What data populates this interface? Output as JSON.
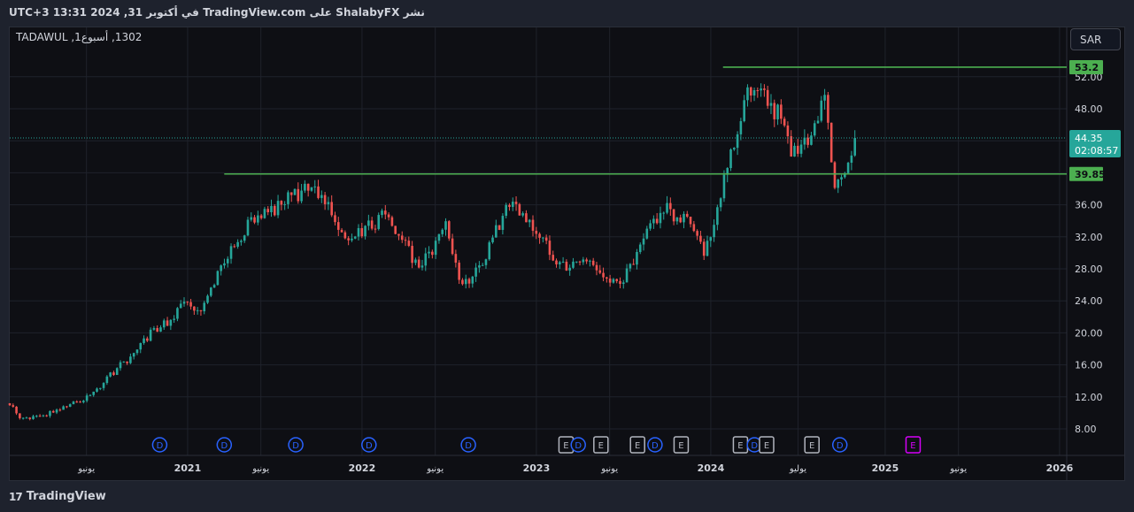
{
  "header": {
    "publish_note": "نشر ShalabyFX على TradingView.com في أكتوبر 31, 2024 13:31 UTC+3",
    "symbol_line": "1302, أسبوع1, TADAWUL",
    "currency": "SAR"
  },
  "footer": {
    "brand_mark": "17",
    "brand": "TradingView"
  },
  "colors": {
    "up": "#26a69a",
    "down": "#ef5350",
    "level": "#4caf50",
    "last_price": "#26a69a",
    "dividend": "#2962ff",
    "earnings": "#b2b5be",
    "earnings_future": "#d500f9",
    "background": "#0e0f14",
    "grid": "#1f222b"
  },
  "chart_data": {
    "type": "candlestick",
    "symbol": "1302",
    "exchange": "TADAWUL",
    "interval": "أسبوع1",
    "currency": "SAR",
    "ylim": [
      6,
      54.5
    ],
    "y_ticks": [
      "8.00",
      "12.00",
      "16.00",
      "20.00",
      "24.00",
      "28.00",
      "32.00",
      "36.00",
      "40.00",
      "44.00",
      "48.00",
      "52.00"
    ],
    "x_ticks": [
      {
        "label": "يونيو",
        "kind": "month",
        "t": 2020.42
      },
      {
        "label": "2021",
        "kind": "year",
        "t": 2021.0
      },
      {
        "label": "يونيو",
        "kind": "month",
        "t": 2021.42
      },
      {
        "label": "2022",
        "kind": "year",
        "t": 2022.0
      },
      {
        "label": "يونيو",
        "kind": "month",
        "t": 2022.42
      },
      {
        "label": "2023",
        "kind": "year",
        "t": 2023.0
      },
      {
        "label": "يونيو",
        "kind": "month",
        "t": 2023.42
      },
      {
        "label": "2024",
        "kind": "year",
        "t": 2024.0
      },
      {
        "label": "يوليو",
        "kind": "month",
        "t": 2024.5
      },
      {
        "label": "2025",
        "kind": "year",
        "t": 2025.0
      },
      {
        "label": "يونيو",
        "kind": "month",
        "t": 2025.42
      },
      {
        "label": "2026",
        "kind": "year",
        "t": 2026.0
      }
    ],
    "price_path": [
      [
        2019.98,
        11.2
      ],
      [
        2020.05,
        9.2
      ],
      [
        2020.12,
        9.6
      ],
      [
        2020.2,
        9.9
      ],
      [
        2020.28,
        10.6
      ],
      [
        2020.38,
        11.4
      ],
      [
        2020.48,
        12.9
      ],
      [
        2020.58,
        15.2
      ],
      [
        2020.68,
        17.2
      ],
      [
        2020.78,
        19.8
      ],
      [
        2020.88,
        21.4
      ],
      [
        2020.98,
        23.5
      ],
      [
        2021.08,
        22.8
      ],
      [
        2021.18,
        27.5
      ],
      [
        2021.28,
        31.5
      ],
      [
        2021.38,
        34.2
      ],
      [
        2021.5,
        35.5
      ],
      [
        2021.62,
        37.3
      ],
      [
        2021.72,
        38.5
      ],
      [
        2021.82,
        35.8
      ],
      [
        2021.92,
        31.0
      ],
      [
        2022.02,
        33.0
      ],
      [
        2022.12,
        34.5
      ],
      [
        2022.22,
        31.8
      ],
      [
        2022.32,
        28.5
      ],
      [
        2022.4,
        30.0
      ],
      [
        2022.48,
        33.5
      ],
      [
        2022.55,
        27.0
      ],
      [
        2022.62,
        26.5
      ],
      [
        2022.7,
        29.0
      ],
      [
        2022.78,
        33.5
      ],
      [
        2022.86,
        36.5
      ],
      [
        2022.94,
        34.0
      ],
      [
        2023.02,
        32.0
      ],
      [
        2023.1,
        29.5
      ],
      [
        2023.18,
        28.0
      ],
      [
        2023.26,
        29.0
      ],
      [
        2023.34,
        28.5
      ],
      [
        2023.42,
        25.8
      ],
      [
        2023.5,
        26.8
      ],
      [
        2023.58,
        29.5
      ],
      [
        2023.66,
        33.5
      ],
      [
        2023.74,
        35.5
      ],
      [
        2023.82,
        34.5
      ],
      [
        2023.9,
        33.5
      ],
      [
        2023.96,
        30.0
      ],
      [
        2024.02,
        34.0
      ],
      [
        2024.08,
        40.0
      ],
      [
        2024.14,
        44.0
      ],
      [
        2024.2,
        49.0
      ],
      [
        2024.26,
        51.5
      ],
      [
        2024.32,
        48.5
      ],
      [
        2024.38,
        47.5
      ],
      [
        2024.44,
        43.5
      ],
      [
        2024.5,
        42.0
      ],
      [
        2024.56,
        44.0
      ],
      [
        2024.62,
        47.5
      ],
      [
        2024.66,
        49.0
      ],
      [
        2024.7,
        39.0
      ],
      [
        2024.74,
        38.5
      ],
      [
        2024.78,
        40.0
      ],
      [
        2024.82,
        42.5
      ],
      [
        2024.84,
        44.35
      ]
    ],
    "levels": [
      {
        "value": 53.2,
        "label": "53.2",
        "t_start": 2024.07
      },
      {
        "value": 39.85,
        "label": "39.85",
        "t_start": 2021.21
      }
    ],
    "last_price": {
      "value": 44.35,
      "label": "44.35",
      "countdown": "02:08:57"
    },
    "events": [
      {
        "type": "D",
        "t": 2020.84
      },
      {
        "type": "D",
        "t": 2021.21
      },
      {
        "type": "D",
        "t": 2021.62
      },
      {
        "type": "D",
        "t": 2022.04
      },
      {
        "type": "D",
        "t": 2022.61
      },
      {
        "type": "E",
        "t": 2023.17
      },
      {
        "type": "D",
        "t": 2023.24
      },
      {
        "type": "E",
        "t": 2023.37
      },
      {
        "type": "E",
        "t": 2023.58
      },
      {
        "type": "D",
        "t": 2023.68
      },
      {
        "type": "E",
        "t": 2023.83
      },
      {
        "type": "E",
        "t": 2024.17
      },
      {
        "type": "D",
        "t": 2024.25
      },
      {
        "type": "E",
        "t": 2024.32
      },
      {
        "type": "E",
        "t": 2024.58
      },
      {
        "type": "D",
        "t": 2024.74
      },
      {
        "type": "E_future",
        "t": 2025.16
      }
    ]
  }
}
